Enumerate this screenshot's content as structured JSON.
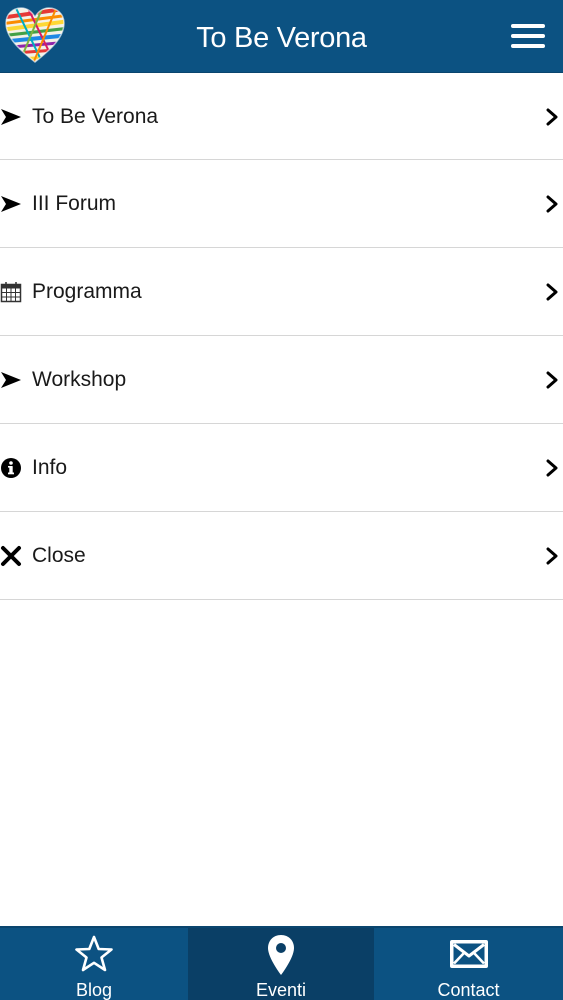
{
  "header": {
    "title": "To Be Verona",
    "logo_icon": "rainbow-heart-icon",
    "menu_icon": "hamburger-menu-icon",
    "background_color": "#0c5282"
  },
  "menu": {
    "items": [
      {
        "label": "To Be Verona",
        "icon": "arrow-right-icon"
      },
      {
        "label": "III Forum",
        "icon": "arrow-right-icon"
      },
      {
        "label": "Programma",
        "icon": "calendar-icon"
      },
      {
        "label": "Workshop",
        "icon": "arrow-right-icon"
      },
      {
        "label": "Info",
        "icon": "info-circle-icon"
      },
      {
        "label": "Close",
        "icon": "close-x-icon"
      }
    ],
    "chevron_icon": "chevron-right-icon"
  },
  "tabbar": {
    "tabs": [
      {
        "label": "Blog",
        "icon": "star-icon",
        "active": false
      },
      {
        "label": "Eventi",
        "icon": "map-pin-icon",
        "active": true
      },
      {
        "label": "Contact",
        "icon": "envelope-icon",
        "active": false
      }
    ],
    "background_color": "#0c5282",
    "active_color": "#0a3f66"
  }
}
